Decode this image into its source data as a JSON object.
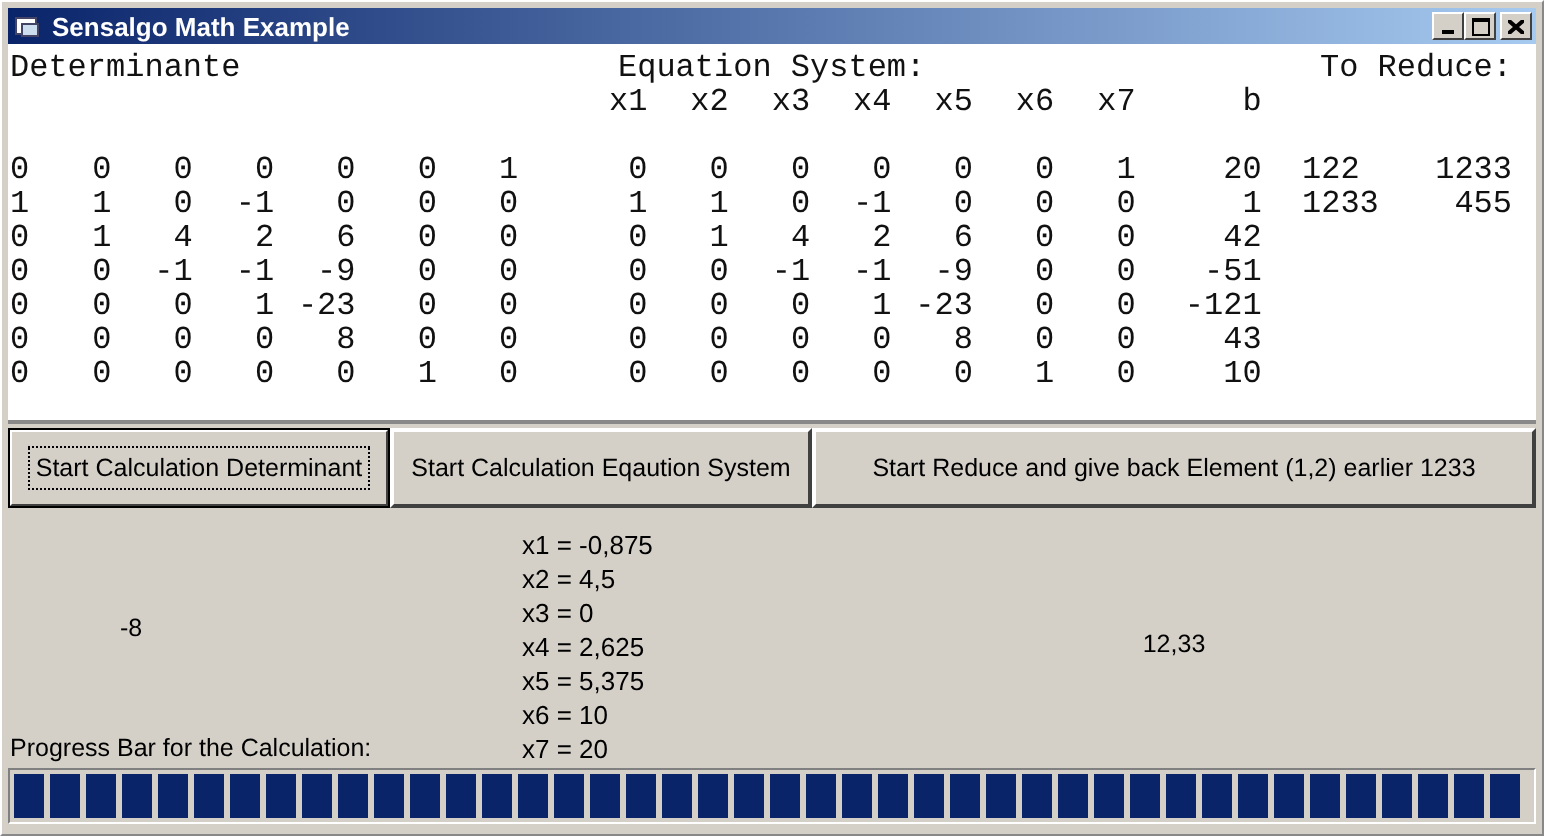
{
  "window": {
    "title": "Sensalgo Math Example"
  },
  "determinant": {
    "title": "Determinante",
    "rows": [
      [
        "0",
        "0",
        "0",
        "0",
        "0",
        "0",
        "1"
      ],
      [
        "1",
        "1",
        "0",
        "-1",
        "0",
        "0",
        "0"
      ],
      [
        "0",
        "1",
        "4",
        "2",
        "6",
        "0",
        "0"
      ],
      [
        "0",
        "0",
        "-1",
        "-1",
        "-9",
        "0",
        "0"
      ],
      [
        "0",
        "0",
        "0",
        "1",
        "-23",
        "0",
        "0"
      ],
      [
        "0",
        "0",
        "0",
        "0",
        "8",
        "0",
        "0"
      ],
      [
        "0",
        "0",
        "0",
        "0",
        "0",
        "1",
        "0"
      ]
    ]
  },
  "equation_system": {
    "title": "Equation System:",
    "columns": [
      "x1",
      "x2",
      "x3",
      "x4",
      "x5",
      "x6",
      "x7",
      "b"
    ],
    "rows": [
      [
        "0",
        "0",
        "0",
        "0",
        "0",
        "0",
        "1",
        "20"
      ],
      [
        "1",
        "1",
        "0",
        "-1",
        "0",
        "0",
        "0",
        "1"
      ],
      [
        "0",
        "1",
        "4",
        "2",
        "6",
        "0",
        "0",
        "42"
      ],
      [
        "0",
        "0",
        "-1",
        "-1",
        "-9",
        "0",
        "0",
        "-51"
      ],
      [
        "0",
        "0",
        "0",
        "1",
        "-23",
        "0",
        "0",
        "-121"
      ],
      [
        "0",
        "0",
        "0",
        "0",
        "8",
        "0",
        "0",
        "43"
      ],
      [
        "0",
        "0",
        "0",
        "0",
        "0",
        "1",
        "0",
        "10"
      ]
    ]
  },
  "to_reduce": {
    "title": "To Reduce:",
    "rows": [
      [
        "122",
        "1233"
      ],
      [
        "1233",
        "455"
      ]
    ]
  },
  "buttons": [
    {
      "label": "Start Calculation Determinant",
      "focused": true
    },
    {
      "label": "Start Calculation Eqaution System",
      "focused": false
    },
    {
      "label": "Start Reduce and give back Element (1,2) earlier 1233",
      "focused": false
    }
  ],
  "results": {
    "determinant": "-8",
    "solutions": [
      "x1 = -0,875",
      "x2 = 4,5",
      "x3 = 0",
      "x4 = 2,625",
      "x5 = 5,375",
      "x6 = 10",
      "x7 = 20"
    ],
    "reduced": "12,33"
  },
  "progress": {
    "label": "Progress Bar for the Calculation:",
    "level": 1
  }
}
